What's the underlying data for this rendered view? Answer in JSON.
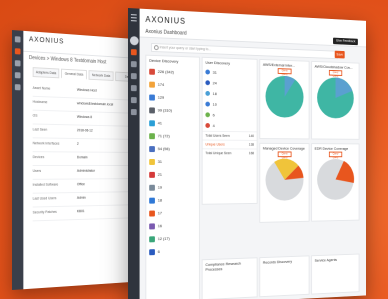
{
  "back_window": {
    "logo": "AXONIUS",
    "breadcrumb": "Devices > Windows 8 Testdomain Host",
    "tabs": [
      "Adapters Data",
      "General Data",
      "Network Data",
      "Dev"
    ],
    "rows": [
      {
        "k": "Asset Name",
        "v": "Windows Host"
      },
      {
        "k": "Hostname",
        "v": "windows8.testdomain.local"
      },
      {
        "k": "OS",
        "v": "Windows 8"
      },
      {
        "k": "Last Seen",
        "v": "2018-06-12"
      },
      {
        "k": "Network Interfaces",
        "v": "2"
      },
      {
        "k": "Devices",
        "v": "Domain"
      },
      {
        "k": "Users",
        "v": "Administrator"
      },
      {
        "k": "Installed Software",
        "v": "Office"
      },
      {
        "k": "Last Used Users",
        "v": "Admin"
      },
      {
        "k": "Security Patches",
        "v": "KB01"
      }
    ]
  },
  "main_window": {
    "logo": "AXONIUS",
    "title": "Axonius Dashboard",
    "account_button": "Give Feedback",
    "search_placeholder": "Insert your query or start typing to...",
    "search_button": "Save",
    "device_card": {
      "title": "Device Discovery",
      "items": [
        {
          "icon": "crowdstrike-icon",
          "color": "#d84a3a",
          "count": "226 (342)"
        },
        {
          "icon": "aws-icon",
          "color": "#f2a33a",
          "count": "174"
        },
        {
          "icon": "azure-icon",
          "color": "#3a7bd5",
          "count": "129"
        },
        {
          "icon": "carbonblack-icon",
          "color": "#5a5f68",
          "count": "99 (310)"
        },
        {
          "icon": "cisco-icon",
          "color": "#2a9fd6",
          "count": "41"
        },
        {
          "icon": "esx-icon",
          "color": "#6cb24c",
          "count": "71 (72)"
        },
        {
          "icon": "sccm-icon",
          "color": "#4a6fbf",
          "count": "54 (56)"
        },
        {
          "icon": "symantec-icon",
          "color": "#f0c43a",
          "count": "31"
        },
        {
          "icon": "mcafee-icon",
          "color": "#d43a3a",
          "count": "21"
        },
        {
          "icon": "jamf-icon",
          "color": "#7a8a9a",
          "count": "19"
        },
        {
          "icon": "windows-icon",
          "color": "#2f78d6",
          "count": "18"
        },
        {
          "icon": "chef-icon",
          "color": "#e8561e",
          "count": "17"
        },
        {
          "icon": "puppet-icon",
          "color": "#7a5ab0",
          "count": "16"
        },
        {
          "icon": "nexpose-icon",
          "color": "#3aa67a",
          "count": "12 (17)"
        },
        {
          "icon": "okta-icon",
          "color": "#2a5bbf",
          "count": "6"
        }
      ]
    },
    "user_card": {
      "title": "User Discovery",
      "items": [
        {
          "icon": "ad-icon",
          "color": "#3a7bd5",
          "count": "31"
        },
        {
          "icon": "okta-icon",
          "color": "#2a5bbf",
          "count": "24"
        },
        {
          "icon": "gsuite-icon",
          "color": "#4a9fd6",
          "count": "18"
        },
        {
          "icon": "azure-ad-icon",
          "color": "#3a7bd5",
          "count": "10"
        },
        {
          "icon": "duo-icon",
          "color": "#6cb24c",
          "count": "6"
        },
        {
          "icon": "slack-icon",
          "color": "#d84a3a",
          "count": "4"
        }
      ],
      "totals": [
        {
          "label": "Total Users Seen",
          "value": "140"
        },
        {
          "label": "Unique Users",
          "value": "138"
        },
        {
          "label": "Total Unique Seen",
          "value": "168"
        }
      ]
    },
    "pie_cards": [
      {
        "title": "AWS/External Inter...",
        "query": "Query Query"
      },
      {
        "title": "AWS/Cloudshadow Cov...",
        "query": "Query Query"
      },
      {
        "title": "Managed Device Coverage",
        "query": "Query Query"
      },
      {
        "title": "EDR Device Coverage",
        "query": "Query Query"
      }
    ],
    "bottom_cards": [
      "Compliance Research Processes",
      "Records Discovery",
      "Service Agents"
    ]
  }
}
